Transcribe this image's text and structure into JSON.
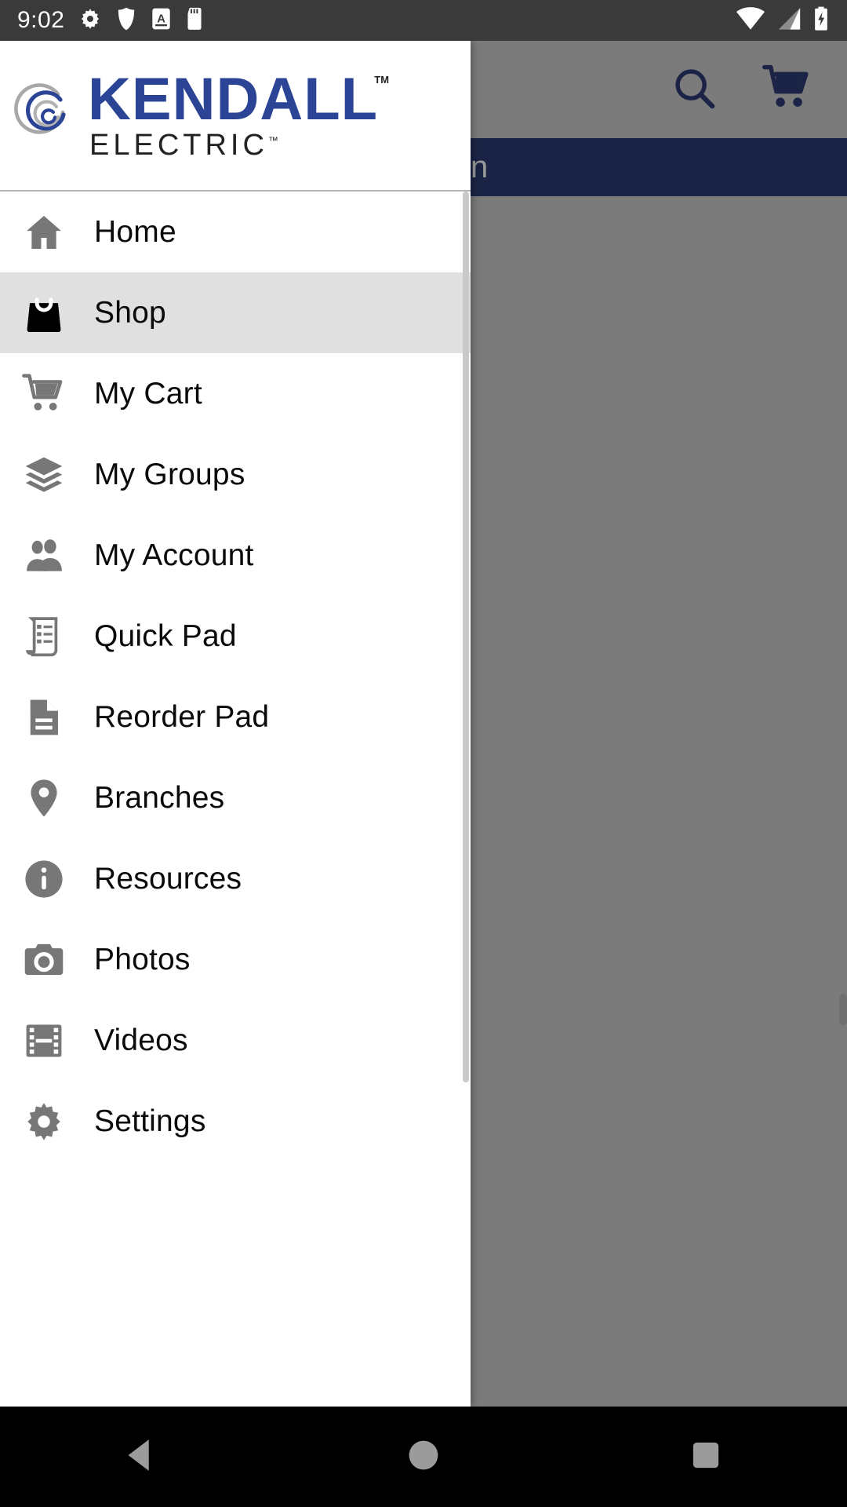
{
  "status_bar": {
    "time": "9:02",
    "left_icons": [
      "gear-icon",
      "shield-icon",
      "letter-a-badge-icon",
      "sd-card-icon"
    ],
    "right_icons": [
      "wifi-icon",
      "cellular-signal-icon",
      "battery-charging-icon"
    ],
    "background": "#3a3a3a",
    "foreground": "#ffffff"
  },
  "background_app": {
    "appbar": {
      "search_icon": "search-icon",
      "cart_icon": "shopping-cart-icon",
      "icon_color": "#1b2447",
      "background": "#7b7b7b"
    },
    "banner": {
      "partial_text": "n",
      "background": "#1b2447"
    },
    "scrim_color": "#7b7b7b"
  },
  "drawer": {
    "background": "#ffffff",
    "brand": {
      "name": "KENDALL",
      "tagline": "ELECTRIC",
      "trademark": "TM",
      "tagline_trademark": "™",
      "brand_color": "#2b4496",
      "mark_icon": "kendall-spiral-logo-icon"
    },
    "selected_item": "Shop",
    "selected_background": "#e0e0e0",
    "items": [
      {
        "label": "Home",
        "icon": "home-icon",
        "selected": false
      },
      {
        "label": "Shop",
        "icon": "shopping-bag-icon",
        "selected": true
      },
      {
        "label": "My Cart",
        "icon": "shopping-cart-icon",
        "selected": false
      },
      {
        "label": "My Groups",
        "icon": "layers-stack-icon",
        "selected": false
      },
      {
        "label": "My Account",
        "icon": "people-icon",
        "selected": false
      },
      {
        "label": "Quick Pad",
        "icon": "receipt-list-icon",
        "selected": false
      },
      {
        "label": "Reorder Pad",
        "icon": "document-icon",
        "selected": false
      },
      {
        "label": "Branches",
        "icon": "location-pin-icon",
        "selected": false
      },
      {
        "label": "Resources",
        "icon": "info-circle-icon",
        "selected": false
      },
      {
        "label": "Photos",
        "icon": "camera-icon",
        "selected": false
      },
      {
        "label": "Videos",
        "icon": "film-strip-icon",
        "selected": false
      },
      {
        "label": "Settings",
        "icon": "gear-icon",
        "selected": false
      }
    ]
  },
  "navigation_bar": {
    "background": "#000000",
    "buttons": [
      {
        "name": "back-button",
        "icon": "triangle-back-icon"
      },
      {
        "name": "home-button",
        "icon": "circle-home-icon"
      },
      {
        "name": "recents-button",
        "icon": "square-recents-icon"
      }
    ]
  }
}
